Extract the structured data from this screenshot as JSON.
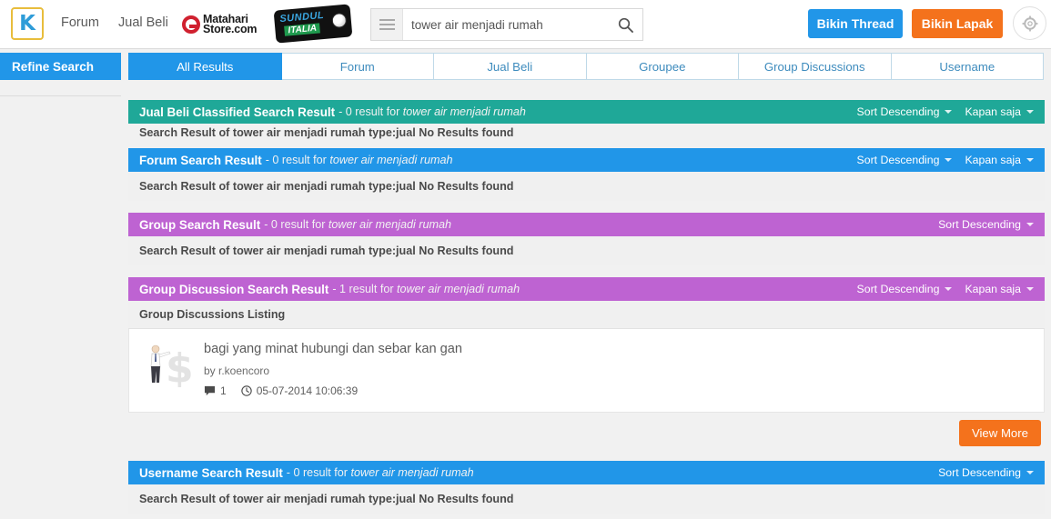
{
  "header": {
    "logo_letter": "K",
    "nav": [
      {
        "label": "Forum",
        "name": "nav-forum"
      },
      {
        "label": "Jual Beli",
        "name": "nav-jual-beli"
      }
    ],
    "matahari": {
      "line1": "Matahari",
      "line2": "Store.com"
    },
    "sundul": {
      "line1": "SUNDUL",
      "line2": "ITALIA"
    },
    "search": {
      "value": "tower air menjadi rumah",
      "placeholder": "tower air menjadi rumah"
    },
    "btn_thread": "Bikin Thread",
    "btn_lapak": "Bikin Lapak"
  },
  "colors": {
    "blue": "#2196e8",
    "orange": "#f4721c",
    "teal": "#1fa898",
    "purple": "#be63d2",
    "logo_border": "#e8bd3c"
  },
  "sidebar": {
    "refine_label": "Refine Search"
  },
  "tabs": [
    {
      "label": "All Results",
      "active": true
    },
    {
      "label": "Forum",
      "active": false
    },
    {
      "label": "Jual Beli",
      "active": false
    },
    {
      "label": "Groupee",
      "active": false
    },
    {
      "label": "Group Discussions",
      "active": false
    },
    {
      "label": "Username",
      "active": false
    }
  ],
  "query": "tower air menjadi rumah",
  "controls": {
    "sort": "Sort Descending",
    "time": "Kapan saja"
  },
  "sections": {
    "jualbeli": {
      "title": "Jual Beli Classified Search Result",
      "count_text": "- 0 result for",
      "query": "tower air menjadi rumah",
      "body": "Search Result of tower air menjadi rumah type:jual No Results found",
      "color": "#1fa898"
    },
    "forum": {
      "title": "Forum Search Result",
      "count_text": "- 0 result for",
      "query": "tower air menjadi rumah",
      "body": "Search Result of tower air menjadi rumah type:jual No Results found",
      "color": "#2196e8"
    },
    "group": {
      "title": "Group Search Result",
      "count_text": "- 0 result for",
      "query": "tower air menjadi rumah",
      "body": "Search Result of tower air menjadi rumah type:jual No Results found",
      "color": "#be63d2"
    },
    "groupdiscussion": {
      "title": "Group Discussion Search Result",
      "count_text": "- 1 result for",
      "query": "tower air menjadi rumah",
      "listing_label": "Group Discussions Listing",
      "color": "#be63d2",
      "result": {
        "title": "bagi yang minat hubungi dan sebar kan gan",
        "by": "by r.koencoro",
        "comments": "1",
        "date": "05-07-2014 10:06:39"
      },
      "view_more": "View More"
    },
    "username": {
      "title": "Username Search Result",
      "count_text": "- 0 result for",
      "query": "tower air menjadi rumah",
      "body": "Search Result of tower air menjadi rumah type:jual No Results found",
      "color": "#2196e8"
    }
  }
}
